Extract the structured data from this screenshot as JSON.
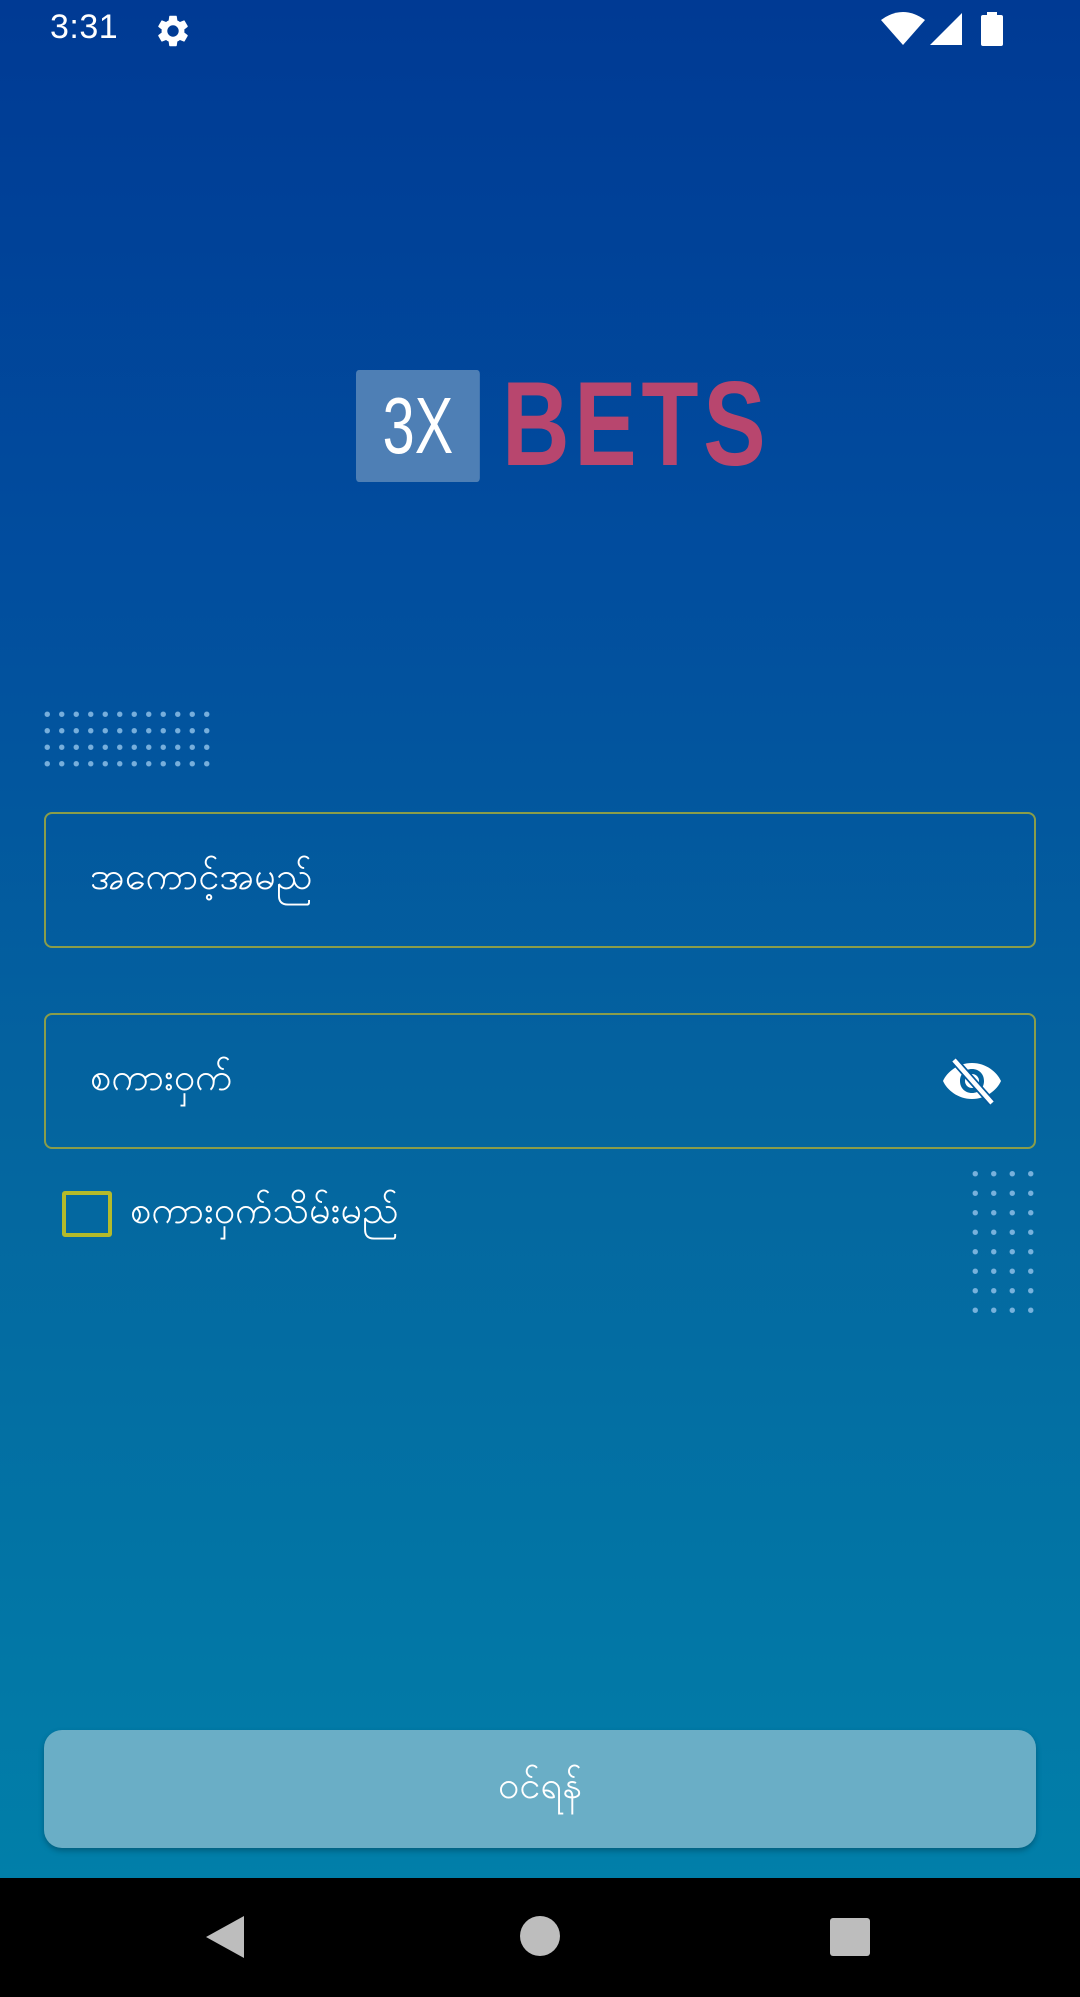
{
  "status_bar": {
    "time": "3:31",
    "icons": [
      "gear-icon",
      "wifi-icon",
      "signal-icon",
      "battery-icon"
    ]
  },
  "logo": {
    "box_text": "3X",
    "word": "BETS",
    "colors": {
      "box": "#4e7fb5",
      "word": "#b8466e"
    }
  },
  "form": {
    "username_placeholder": "အကောင့်အမည်",
    "password_placeholder": "စကားဝှက်",
    "password_toggle_icon": "eye-off-icon",
    "remember_label": "စကားဝှက်သိမ်းမည်",
    "remember_checked": false,
    "login_label": "ဝင်ရန်"
  },
  "theme": {
    "gradient_top": "#003a94",
    "gradient_bottom": "#017fa9",
    "field_border": "#8a9d4a",
    "checkbox_border": "#b4ba2a",
    "button_bg": "#6aaec6"
  },
  "nav_bar": {
    "icons": [
      "back-icon",
      "home-icon",
      "recents-icon"
    ]
  }
}
